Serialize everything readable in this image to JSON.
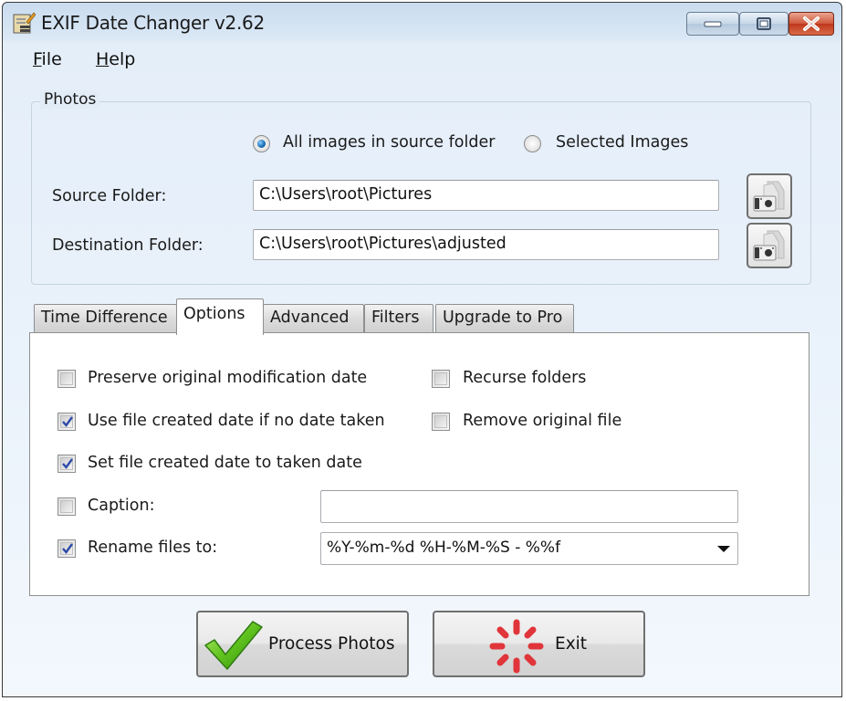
{
  "window": {
    "title": "EXIF Date Changer v2.62",
    "icon": "app-notepad-pencil-icon",
    "controls": [
      "minimize",
      "maximize",
      "close"
    ]
  },
  "menu": {
    "items": [
      {
        "label": "File",
        "mnemonic": "F",
        "rest": "ile"
      },
      {
        "label": "Help",
        "mnemonic": "H",
        "rest": "elp"
      }
    ]
  },
  "photos": {
    "group_title": "Photos",
    "radios": [
      {
        "label": "All images in source folder",
        "selected": true
      },
      {
        "label": "Selected Images",
        "selected": false
      }
    ],
    "source_label": "Source Folder:",
    "source_value": "C:\\Users\\root\\Pictures",
    "destination_label": "Destination Folder:",
    "destination_value": "C:\\Users\\root\\Pictures\\adjusted",
    "browse_icon": "camera-folder-icon"
  },
  "tabs": {
    "items": [
      {
        "label": "Time Difference",
        "active": false
      },
      {
        "label": "Options",
        "active": true
      },
      {
        "label": "Advanced",
        "active": false
      },
      {
        "label": "Filters",
        "active": false
      },
      {
        "label": "Upgrade to Pro",
        "active": false
      }
    ]
  },
  "options": {
    "preserve_mod_date": {
      "label": "Preserve original modification date",
      "checked": false
    },
    "use_created_date": {
      "label": "Use file created date if no date taken",
      "checked": true
    },
    "set_created_date": {
      "label": "Set file created date to taken date",
      "checked": true
    },
    "caption": {
      "label": "Caption:",
      "checked": false,
      "value": ""
    },
    "rename": {
      "label": "Rename files to:",
      "checked": true,
      "value": "%Y-%m-%d %H-%M-%S - %%f"
    },
    "recurse": {
      "label": "Recurse folders",
      "checked": false
    },
    "remove_original": {
      "label": "Remove original file",
      "checked": false
    }
  },
  "actions": {
    "process_label": "Process Photos",
    "process_icon": "green-checkmark-icon",
    "exit_label": "Exit",
    "exit_icon": "red-spinner-icon"
  },
  "colors": {
    "check_mark": "#2c4aa8",
    "radio_dot": "#1e6fb8",
    "close_button": "#c9432a",
    "process_icon": "#5fc21e",
    "exit_icon": "#e0353a"
  }
}
